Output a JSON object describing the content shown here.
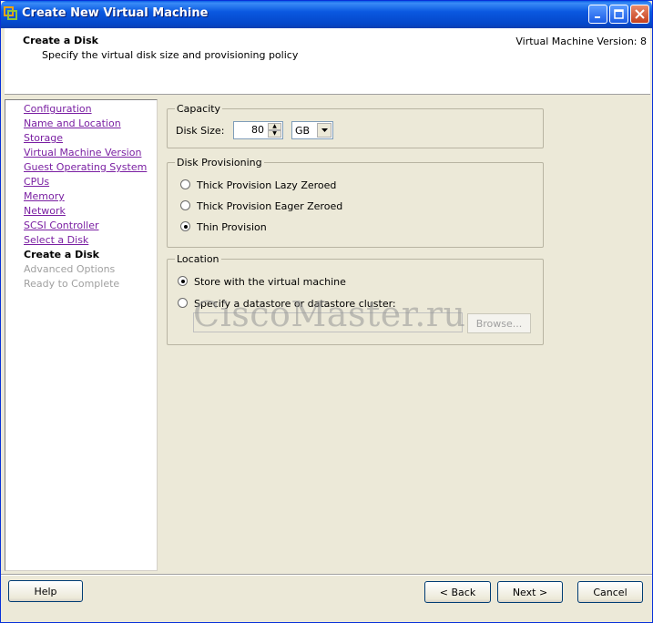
{
  "window": {
    "title": "Create New Virtual Machine",
    "icon": "vmware-icon"
  },
  "header": {
    "title": "Create a Disk",
    "subtitle": "Specify the virtual disk size and provisioning policy",
    "version": "Virtual Machine Version: 8"
  },
  "nav": {
    "items": [
      {
        "label": "Configuration",
        "state": "visited"
      },
      {
        "label": "Name and Location",
        "state": "visited"
      },
      {
        "label": "Storage",
        "state": "visited"
      },
      {
        "label": "Virtual Machine Version",
        "state": "visited"
      },
      {
        "label": "Guest Operating System",
        "state": "visited"
      },
      {
        "label": "CPUs",
        "state": "visited"
      },
      {
        "label": "Memory",
        "state": "visited"
      },
      {
        "label": "Network",
        "state": "visited"
      },
      {
        "label": "SCSI Controller",
        "state": "visited"
      },
      {
        "label": "Select a Disk",
        "state": "visited"
      },
      {
        "label": "Create a Disk",
        "state": "current"
      },
      {
        "label": "Advanced Options",
        "state": "disabled"
      },
      {
        "label": "Ready to Complete",
        "state": "disabled"
      }
    ]
  },
  "capacity": {
    "legend": "Capacity",
    "disk_size_label": "Disk Size:",
    "disk_size_value": "80",
    "unit_value": "GB"
  },
  "provisioning": {
    "legend": "Disk Provisioning",
    "options": [
      {
        "label": "Thick Provision Lazy Zeroed",
        "selected": false
      },
      {
        "label": "Thick Provision Eager Zeroed",
        "selected": false
      },
      {
        "label": "Thin Provision",
        "selected": true
      }
    ]
  },
  "location": {
    "legend": "Location",
    "options": [
      {
        "label": "Store with the virtual machine",
        "selected": true
      },
      {
        "label": "Specify a datastore or datastore cluster:",
        "selected": false
      }
    ],
    "browse_label": "Browse..."
  },
  "watermark": "CiscoMaster.ru",
  "footer": {
    "help_label": "Help",
    "back_label": "< Back",
    "next_label": "Next >",
    "cancel_label": "Cancel"
  }
}
